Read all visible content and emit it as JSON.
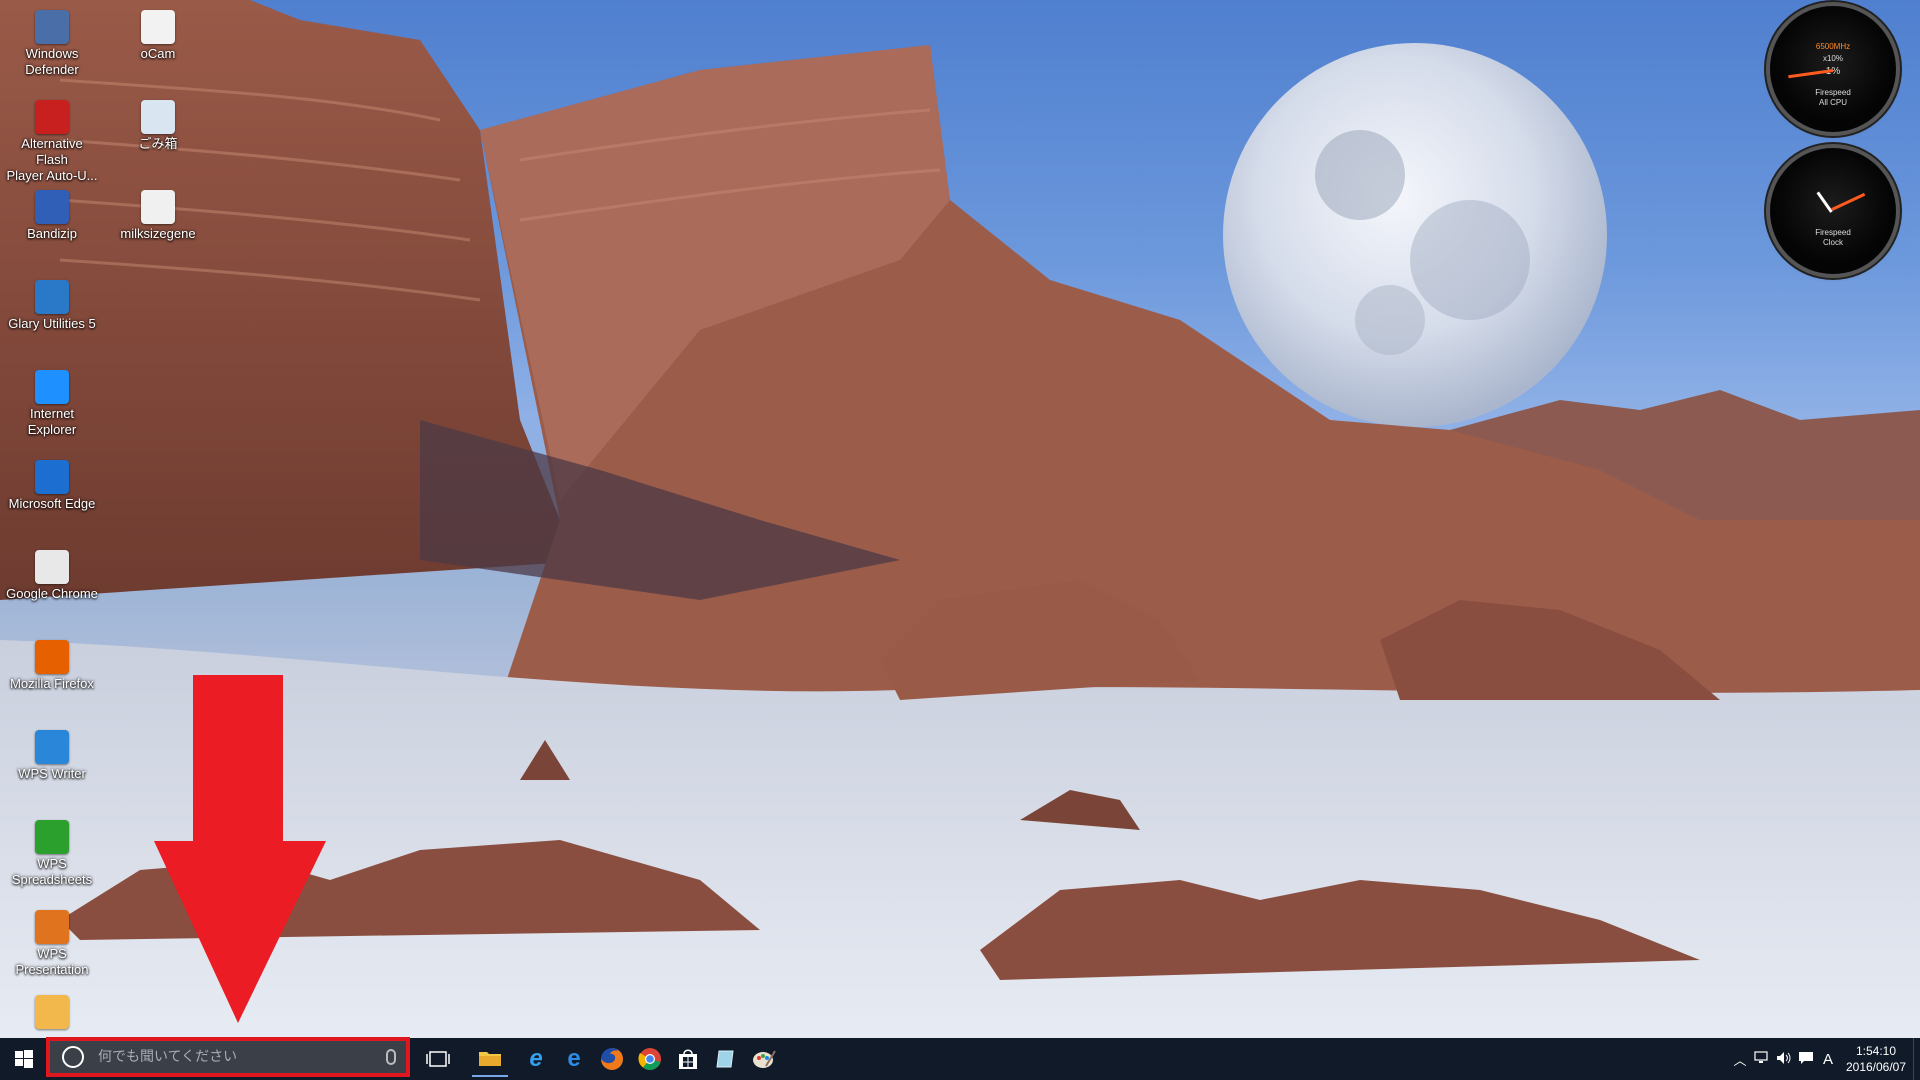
{
  "desktop": {
    "icons": [
      {
        "label": "Windows\nDefender",
        "icon": "windows-defender-icon",
        "color": "#4a6ea8"
      },
      {
        "label": "oCam",
        "icon": "ocam-icon",
        "color": "#f2f2f2"
      },
      {
        "label": "Alternative Flash\nPlayer Auto-U...",
        "icon": "flash-updater-icon",
        "color": "#c8201e"
      },
      {
        "label": "ごみ箱",
        "icon": "recycle-bin-icon",
        "color": "#d9e6f2"
      },
      {
        "label": "Bandizip",
        "icon": "bandizip-icon",
        "color": "#2f5fb7"
      },
      {
        "label": "milksizegene",
        "icon": "milksizegene-icon",
        "color": "#f0f0f0"
      },
      {
        "label": "Glary Utilities 5",
        "icon": "glary-utilities-icon",
        "color": "#2a78c8"
      },
      {
        "label": "Internet Explorer",
        "icon": "internet-explorer-icon",
        "color": "#1e90ff"
      },
      {
        "label": "Microsoft Edge",
        "icon": "edge-icon",
        "color": "#1c6fd1"
      },
      {
        "label": "Google Chrome",
        "icon": "chrome-icon",
        "color": "#e8e8e8"
      },
      {
        "label": "Mozilla Firefox",
        "icon": "firefox-icon",
        "color": "#e66000"
      },
      {
        "label": "WPS Writer",
        "icon": "wps-writer-icon",
        "color": "#2a86d8"
      },
      {
        "label": "WPS\nSpreadsheets",
        "icon": "wps-spreadsheets-icon",
        "color": "#2ca02c"
      },
      {
        "label": "WPS Presentation",
        "icon": "wps-presentation-icon",
        "color": "#e0731e"
      },
      {
        "label": "",
        "icon": "document-icon",
        "color": "#f2b84b"
      }
    ]
  },
  "gadgets": {
    "cpu": {
      "line1": "6500MHz",
      "line2": "x10%",
      "line3": "Firespeed",
      "line4": "All CPU",
      "value": "1%"
    },
    "clock": {
      "line1": "Firespeed",
      "line2": "Clock"
    }
  },
  "taskbar": {
    "search_placeholder": "何でも聞いてください",
    "pinned": [
      "task-view-icon",
      "file-explorer-icon",
      "internet-explorer-icon",
      "edge-icon",
      "firefox-icon",
      "chrome-icon",
      "store-icon",
      "notes-icon",
      "paint-icon"
    ],
    "tray": {
      "ime": "A",
      "time": "1:54:10",
      "date": "2016/06/07"
    }
  },
  "colors": {
    "taskbar": "#101a28",
    "highlight_border": "#e0171e",
    "arrow": "#ec1c24"
  }
}
